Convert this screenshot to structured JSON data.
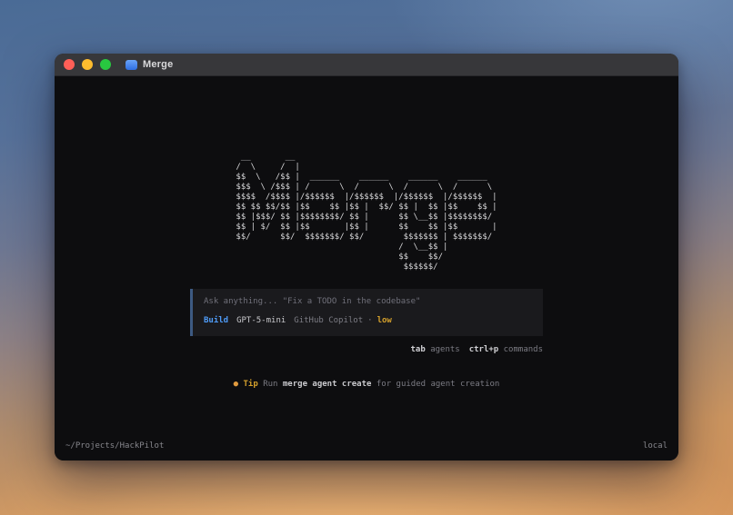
{
  "window": {
    "title": "Merge",
    "traffic_lights": [
      {
        "name": "close",
        "color": "#ff5f57"
      },
      {
        "name": "minimize",
        "color": "#febc2e"
      },
      {
        "name": "zoom",
        "color": "#28c840"
      }
    ]
  },
  "terminal": {
    "ascii_logo": [
      " __       __ ",
      "/  \\     /  |",
      "$$  \\   /$$ |  ______    ______    ______    ______  ",
      "$$$  \\ /$$$ | /      \\  /      \\  /      \\  /      \\ ",
      "$$$$  /$$$$ |/$$$$$$  |/$$$$$$  |/$$$$$$  |/$$$$$$  |",
      "$$ $$ $$/$$ |$$    $$ |$$ |  $$/ $$ |  $$ |$$    $$ |",
      "$$ |$$$/ $$ |$$$$$$$$/ $$ |      $$ \\__$$ |$$$$$$$$/ ",
      "$$ | $/  $$ |$$       |$$ |      $$    $$ |$$       |",
      "$$/      $$/  $$$$$$$/ $$/        $$$$$$$ | $$$$$$$/ ",
      "                                 /  \\__$$ |          ",
      "                                 $$    $$/           ",
      "                                  $$$$$$/            "
    ],
    "prompt": {
      "placeholder": "Ask anything... \"Fix a TODO in the codebase\"",
      "mode": "Build",
      "model": "GPT-5-mini",
      "provider": "GitHub Copilot",
      "separator": "·",
      "reasoning_effort": "low"
    },
    "hints": [
      {
        "key": "tab",
        "label": "agents"
      },
      {
        "key": "ctrl+p",
        "label": "commands"
      }
    ],
    "tip": {
      "bullet": "●",
      "label": "Tip",
      "before": "Run",
      "command": "merge agent create",
      "after": "for guided agent creation"
    },
    "status_bar": {
      "cwd": "~/Projects/HackPilot",
      "mode": "local"
    }
  },
  "colors": {
    "accent_blue": "#4f9cf9",
    "reasoning_yellow": "#d4a02c",
    "tip_orange": "#e09a3e",
    "prompt_accent_border": "#3d5a82",
    "terminal_background": "#0d0d0f",
    "titlebar_background": "#37373a"
  }
}
